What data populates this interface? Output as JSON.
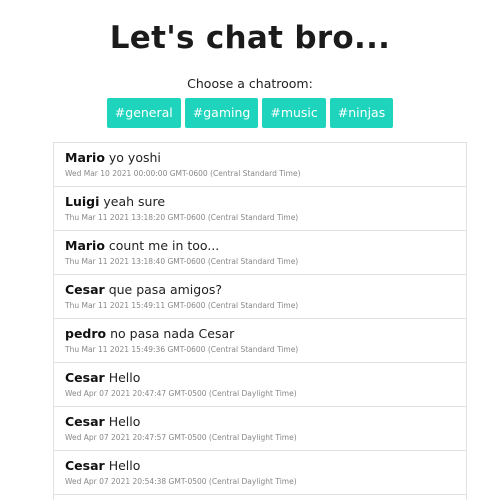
{
  "header": {
    "title": "Let's chat bro...",
    "subtitle": "Choose a chatroom:"
  },
  "rooms": [
    {
      "label": "#general"
    },
    {
      "label": "#gaming"
    },
    {
      "label": "#music"
    },
    {
      "label": "#ninjas"
    }
  ],
  "colors": {
    "accent": "#1ed4bd"
  },
  "messages": [
    {
      "name": "Mario",
      "text": "yo yoshi",
      "time": "Wed Mar 10 2021 00:00:00 GMT-0600 (Central Standard Time)"
    },
    {
      "name": "Luigi",
      "text": "yeah sure",
      "time": "Thu Mar 11 2021 13:18:20 GMT-0600 (Central Standard Time)"
    },
    {
      "name": "Mario",
      "text": "count me in too...",
      "time": "Thu Mar 11 2021 13:18:40 GMT-0600 (Central Standard Time)"
    },
    {
      "name": "Cesar",
      "text": "que pasa amigos?",
      "time": "Thu Mar 11 2021 15:49:11 GMT-0600 (Central Standard Time)"
    },
    {
      "name": "pedro",
      "text": "no pasa nada Cesar",
      "time": "Thu Mar 11 2021 15:49:36 GMT-0600 (Central Standard Time)"
    },
    {
      "name": "Cesar",
      "text": "Hello",
      "time": "Wed Apr 07 2021 20:47:47 GMT-0500 (Central Daylight Time)"
    },
    {
      "name": "Cesar",
      "text": "Hello",
      "time": "Wed Apr 07 2021 20:47:57 GMT-0500 (Central Daylight Time)"
    },
    {
      "name": "Cesar",
      "text": "Hello",
      "time": "Wed Apr 07 2021 20:54:38 GMT-0500 (Central Daylight Time)"
    }
  ]
}
